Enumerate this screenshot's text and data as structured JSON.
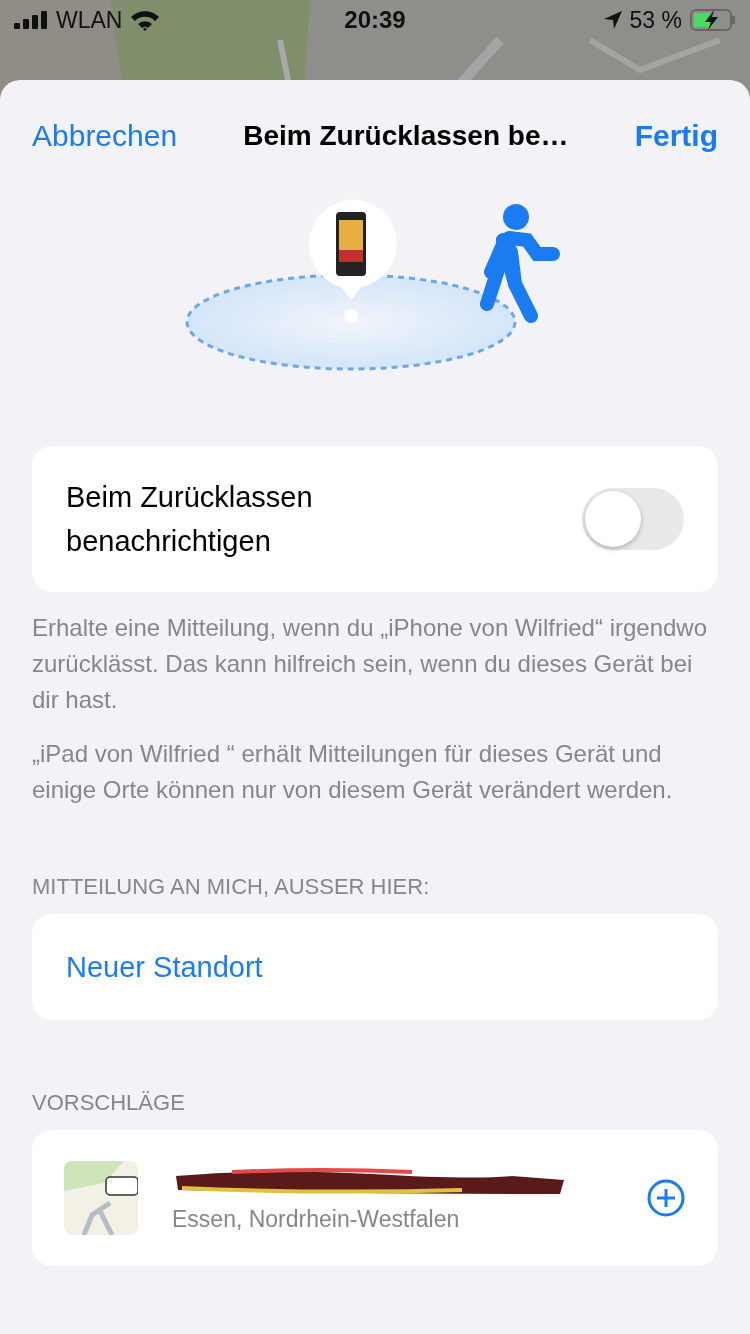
{
  "status_bar": {
    "carrier": "WLAN",
    "time": "20:39",
    "battery": "53 %"
  },
  "nav": {
    "cancel": "Abbrechen",
    "title": "Beim Zurücklassen be…",
    "done": "Fertig"
  },
  "notify_toggle": {
    "label": "Beim Zurücklassen benachrichtigen",
    "on": false
  },
  "notes": [
    "Erhalte eine Mitteilung, wenn du „iPhone von Wilfried“ irgendwo zurücklässt. Das kann hilfreich sein, wenn du dieses Gerät bei dir hast.",
    "„iPad von Wilfried “ erhält Mitteilungen für dieses Gerät und einige Orte können nur von diesem Gerät verändert werden."
  ],
  "exceptions": {
    "header": "MITTEILUNG AN MICH, AUSSER HIER:",
    "new_location": "Neuer Standort"
  },
  "suggestions": {
    "header": "VORSCHLÄGE",
    "items": [
      {
        "subtitle": "Essen, Nordrhein-Westfalen"
      }
    ]
  }
}
